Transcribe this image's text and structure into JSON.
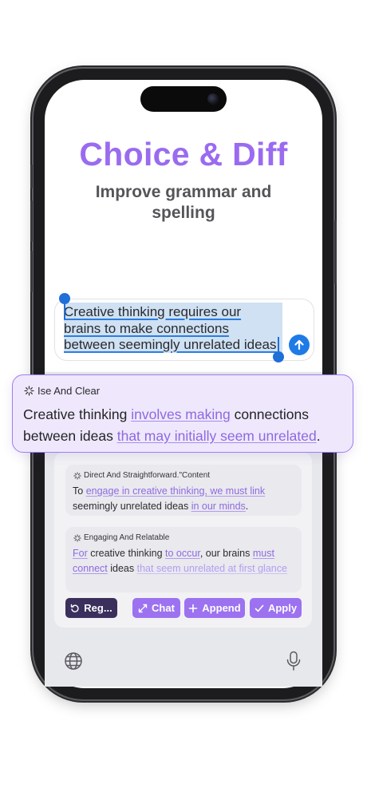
{
  "header": {
    "title": "Choice & Diff",
    "subtitle": "Improve grammar and spelling"
  },
  "input": {
    "text_line1": "Creative thinking requires our",
    "text_line2": "brains to make connections",
    "text_line3": "between seemingly unrelated ideas",
    "send_icon": "arrow-up-icon"
  },
  "popup": {
    "label": "Ise And Clear",
    "icon": "sparkle-icon",
    "segments": [
      {
        "text": "Creative thinking ",
        "changed": false
      },
      {
        "text": "involves making",
        "changed": true
      },
      {
        "text": " connections between ideas ",
        "changed": false
      },
      {
        "text": "that may initially seem unrelated",
        "changed": true
      },
      {
        "text": ".",
        "changed": false
      }
    ]
  },
  "options": [
    {
      "label": "Direct And Straightforward.\"Content",
      "segments": [
        {
          "text": "To ",
          "changed": false
        },
        {
          "text": "engage in creative thinking, we must link",
          "changed": true
        },
        {
          "text": " seemingly unrelated ideas ",
          "changed": false
        },
        {
          "text": "in our minds",
          "changed": true
        },
        {
          "text": ".",
          "changed": false
        }
      ]
    },
    {
      "label": "Engaging And Relatable",
      "segments": [
        {
          "text": "For",
          "changed": true
        },
        {
          "text": " creative thinking ",
          "changed": false
        },
        {
          "text": "to occur",
          "changed": true
        },
        {
          "text": ", our brains ",
          "changed": false
        },
        {
          "text": "must connect",
          "changed": true
        },
        {
          "text": " ideas ",
          "changed": false
        },
        {
          "text": "that seem unrelated at first glance",
          "changed": true
        }
      ]
    }
  ],
  "actions": {
    "regenerate": "Reg...",
    "chat": "Chat",
    "append": "Append",
    "apply": "Apply"
  },
  "keyboard": {
    "left_icon": "globe-icon",
    "right_icon": "microphone-icon"
  },
  "colors": {
    "accent": "#9a6bf0",
    "selection": "#cfe1f3",
    "send": "#1e7be6",
    "dark_button": "#3b2f5c"
  }
}
